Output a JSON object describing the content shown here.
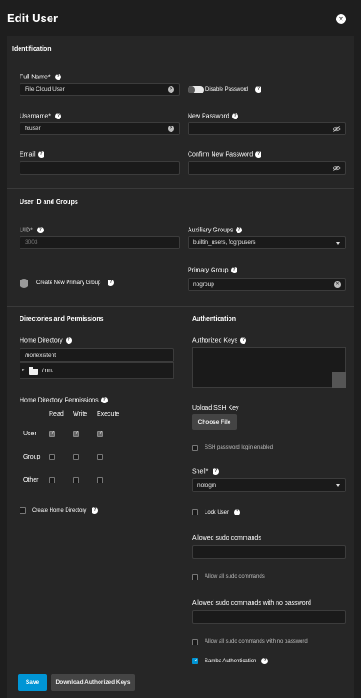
{
  "dialog": {
    "title": "Edit User"
  },
  "identification": {
    "section_title": "Identification",
    "full_name_label": "Full Name",
    "full_name_value": "File Cloud User",
    "disable_password_label": "Disable Password",
    "username_label": "Username",
    "username_value": "fcuser",
    "new_password_label": "New Password",
    "email_label": "Email",
    "email_value": "",
    "confirm_password_label": "Confirm New Password"
  },
  "uid_groups": {
    "section_title": "User ID and Groups",
    "uid_label": "UID",
    "uid_value": "3003",
    "aux_groups_label": "Auxiliary Groups",
    "aux_groups_value": "builtin_users, fcgrpusers",
    "create_primary_group_label": "Create New Primary Group",
    "primary_group_label": "Primary Group",
    "primary_group_value": "nogroup"
  },
  "directories": {
    "section_title": "Directories and Permissions",
    "home_dir_label": "Home Directory",
    "home_dir_value": "/nonexistent",
    "tree_item": "/mnt",
    "permissions_label": "Home Directory Permissions",
    "perm_columns": [
      "Read",
      "Write",
      "Execute"
    ],
    "perm_rows": [
      "User",
      "Group",
      "Other"
    ],
    "create_home_label": "Create Home Directory"
  },
  "authentication": {
    "section_title": "Authentication",
    "authorized_keys_label": "Authorized Keys",
    "upload_ssh_label": "Upload SSH Key",
    "choose_file_label": "Choose File",
    "ssh_password_login_label": "SSH password login enabled",
    "shell_label": "Shell",
    "shell_value": "nologin",
    "lock_user_label": "Lock User",
    "sudo_commands_label": "Allowed sudo commands",
    "allow_all_sudo_label": "Allow all sudo commands",
    "sudo_nopasswd_label": "Allowed sudo commands with no password",
    "allow_all_sudo_nopasswd_label": "Allow all sudo commands with no password",
    "samba_auth_label": "Samba Authentication"
  },
  "footer": {
    "save_label": "Save",
    "download_keys_label": "Download Authorized Keys"
  },
  "colors": {
    "accent": "#0095d5",
    "background": "#1e1e1e",
    "panel": "#262626"
  }
}
